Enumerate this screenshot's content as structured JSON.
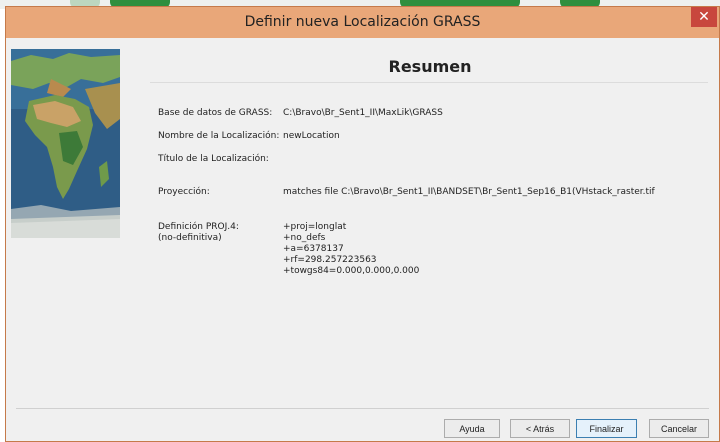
{
  "window": {
    "title": "Definir nueva Localización GRASS",
    "close_glyph": "✕"
  },
  "page": {
    "heading": "Resumen"
  },
  "fields": [
    {
      "label": "Base de datos de GRASS:",
      "value": "C:\\Bravo\\Br_Sent1_II\\MaxLik\\GRASS"
    },
    {
      "label": "Nombre de la Localización:",
      "value": "newLocation"
    },
    {
      "label": "Título de la Localización:",
      "value": ""
    },
    {
      "label": "Proyección:",
      "value": "matches file C:\\Bravo\\Br_Sent1_II\\BANDSET\\Br_Sent1_Sep16_B1(VHstack_raster.tif"
    }
  ],
  "proj4": {
    "label_line1": "Definición PROJ.4:",
    "label_line2": "(no-definitiva)",
    "lines": [
      "+proj=longlat",
      "+no_defs",
      "+a=6378137",
      "+rf=298.257223563",
      "+towgs84=0.000,0.000,0.000"
    ]
  },
  "buttons": {
    "help": "Ayuda",
    "back": "< Atrás",
    "finish": "Finalizar",
    "cancel": "Cancelar"
  },
  "icons": {
    "close": "close-icon",
    "side_image": "world-map-image"
  }
}
